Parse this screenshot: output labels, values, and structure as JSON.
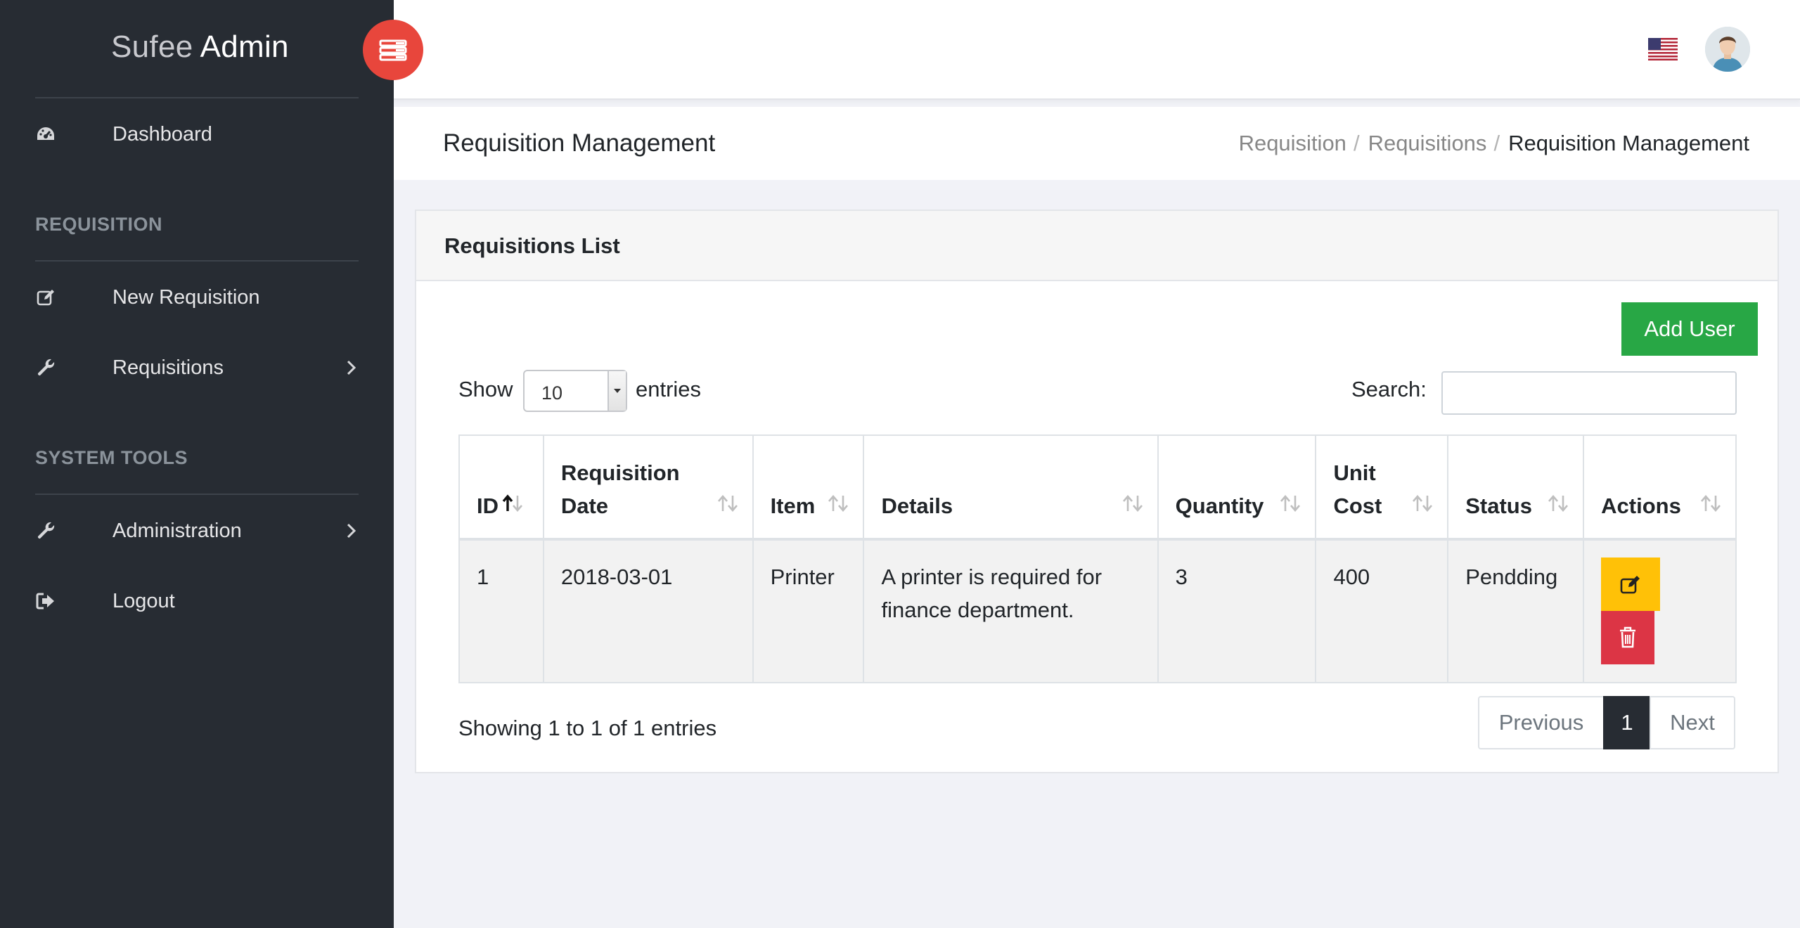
{
  "brand": {
    "light": "Sufee",
    "bold": "Admin"
  },
  "sidebar": {
    "dashboard": "Dashboard",
    "section_requisition": "REQUISITION",
    "new_requisition": "New Requisition",
    "requisitions": "Requisitions",
    "section_tools": "SYSTEM TOOLS",
    "administration": "Administration",
    "logout": "Logout"
  },
  "header": {
    "page_title": "Requisition Management",
    "breadcrumb": [
      "Requisition",
      "Requisitions",
      "Requisition Management"
    ],
    "breadcrumb_sep": "/"
  },
  "card": {
    "title": "Requisitions List",
    "add_button": "Add User",
    "show_label": "Show",
    "entries_label": "entries",
    "page_length": "10",
    "search_label": "Search:",
    "search_value": ""
  },
  "table": {
    "columns": [
      "ID",
      "Requisition Date",
      "Item",
      "Details",
      "Quantity",
      "Unit Cost",
      "Status",
      "Actions"
    ],
    "rows": [
      {
        "id": "1",
        "date": "2018-03-01",
        "item": "Printer",
        "details": "A printer is required for finance department.",
        "quantity": "3",
        "unit_cost": "400",
        "status": "Pendding"
      }
    ]
  },
  "footer": {
    "info": "Showing 1 to 1 of 1 entries",
    "previous": "Previous",
    "current_page": "1",
    "next": "Next"
  },
  "colors": {
    "sidebar": "#272c33",
    "toggle": "#e8463c",
    "add": "#28a745",
    "edit": "#ffc107",
    "delete": "#dc3545"
  }
}
